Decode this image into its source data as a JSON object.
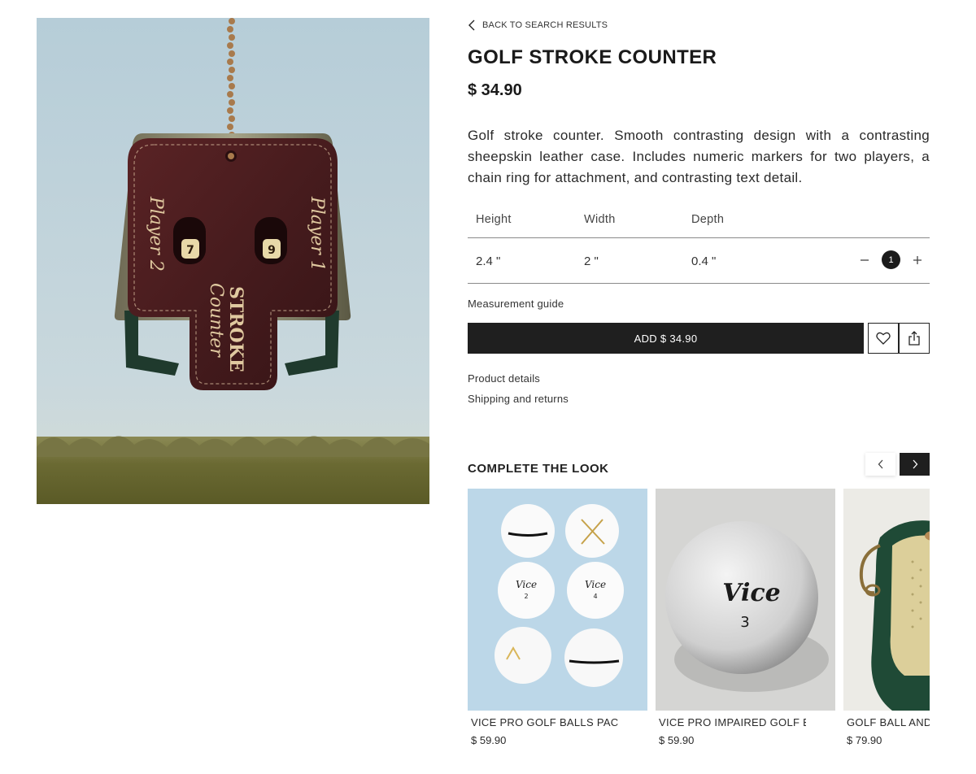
{
  "product": {
    "back_label": "BACK TO SEARCH RESULTS",
    "title": "GOLF STROKE COUNTER",
    "price": "$ 34.90",
    "description": "Golf stroke counter. Smooth contrasting design with a contrasting sheepskin leather case. Includes numeric markers for two players, a chain ring for attachment, and contrasting text detail.",
    "image_text": {
      "player_left": "Player 2",
      "player_right": "Player 1",
      "brand_top": "STROKE",
      "brand_bottom": "Counter",
      "digit_left": "7",
      "digit_right": "9"
    }
  },
  "dimensions": {
    "headers": [
      "Height",
      "Width",
      "Depth"
    ],
    "values": [
      "2.4 \"",
      "2 \"",
      "0.4 \""
    ]
  },
  "quantity": {
    "value": "1",
    "minus_icon": "minus-icon",
    "plus_icon": "plus-icon"
  },
  "measurement_guide_label": "Measurement guide",
  "add_button_label": "ADD $ 34.90",
  "icons": {
    "favorite": "heart-icon",
    "share": "share-icon"
  },
  "links": {
    "product_details": "Product details",
    "shipping": "Shipping and returns"
  },
  "complete_the_look": {
    "title": "COMPLETE THE LOOK",
    "items": [
      {
        "name": "VICE PRO GOLF BALLS PACK (...",
        "price": "$ 59.90"
      },
      {
        "name": "VICE PRO IMPAIRED GOLF BA...",
        "price": "$ 59.90"
      },
      {
        "name": "GOLF BALL AND T",
        "price": "$ 79.90"
      }
    ],
    "ball_text": {
      "brand": "Vice",
      "num_a": "2",
      "num_b": "4",
      "num_c": "3"
    }
  },
  "colors": {
    "primary_button": "#1f1f1f",
    "leather": "#4a1d1e",
    "sky": "#b9cfd9"
  }
}
